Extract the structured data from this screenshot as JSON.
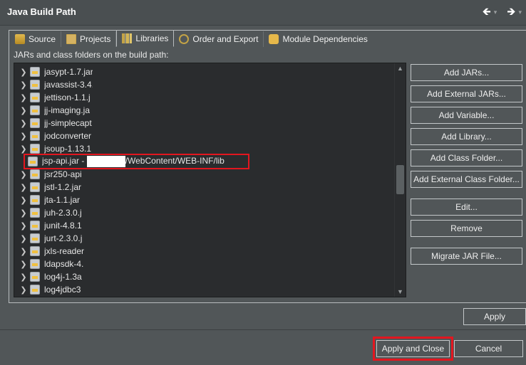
{
  "window": {
    "title": "Java Build Path"
  },
  "nav": {
    "back_icon": "back-arrow-icon",
    "forward_icon": "forward-arrow-icon",
    "dropdown_glyph": "▾"
  },
  "tabs": [
    {
      "label": "Source",
      "icon": "source-folder-icon"
    },
    {
      "label": "Projects",
      "icon": "projects-icon"
    },
    {
      "label": "Libraries",
      "icon": "libraries-icon",
      "active": true
    },
    {
      "label": "Order and Export",
      "icon": "order-export-icon"
    },
    {
      "label": "Module Dependencies",
      "icon": "module-icon"
    }
  ],
  "libraries": {
    "description": "JARs and class folders on the build path:",
    "items": [
      {
        "label": "jasypt-1.7.jar"
      },
      {
        "label": "javassist-3.4."
      },
      {
        "label": "jettison-1.1.j"
      },
      {
        "label": "jj-imaging.ja"
      },
      {
        "label": "jj-simplecapt"
      },
      {
        "label": "jodconverter"
      },
      {
        "label": "jsoup-1.13.1"
      },
      {
        "label_prefix": "jsp-api.jar - ",
        "label_suffix": "/WebContent/WEB-INF/lib",
        "highlighted": true
      },
      {
        "label": "jsr250-api"
      },
      {
        "label": "jstl-1.2.jar"
      },
      {
        "label": "jta-1.1.jar"
      },
      {
        "label": "juh-2.3.0.j"
      },
      {
        "label": "junit-4.8.1"
      },
      {
        "label": "jurt-2.3.0.j"
      },
      {
        "label": "jxls-reader"
      },
      {
        "label": "ldapsdk-4."
      },
      {
        "label": "log4j-1.3a"
      },
      {
        "label": "log4jdbc3"
      }
    ],
    "buttons": {
      "add_jars": "Add JARs...",
      "add_external_jars": "Add External JARs...",
      "add_variable": "Add Variable...",
      "add_library": "Add Library...",
      "add_class_folder": "Add Class Folder...",
      "add_external_class_folder": "Add External Class Folder...",
      "edit": "Edit...",
      "remove": "Remove",
      "migrate_jar": "Migrate JAR File..."
    }
  },
  "footer": {
    "apply": "Apply",
    "apply_and_close": "Apply and Close",
    "cancel": "Cancel"
  },
  "colors": {
    "highlight": "#e3161f",
    "list_background": "#2a2c2e",
    "dialog_background": "#515658"
  }
}
